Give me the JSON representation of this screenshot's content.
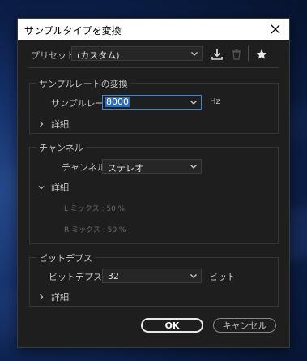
{
  "window": {
    "title": "サンプルタイプを変換"
  },
  "preset": {
    "label": "プリセット :",
    "value": "(カスタム)"
  },
  "toolbar": {
    "icons": [
      "download-icon",
      "trash-icon",
      "star-icon"
    ]
  },
  "sample_rate_group": {
    "title": "サンプルレートの変換",
    "label": "サンプルレート :",
    "value": "8000",
    "unit": "Hz",
    "details_label": "詳細",
    "details_expanded": false
  },
  "channel_group": {
    "title": "チャンネル",
    "label": "チャンネル :",
    "value": "ステレオ",
    "details_label": "詳細",
    "details_expanded": true,
    "l_mix": "L ミックス : 50 %",
    "r_mix": "R ミックス : 50 %"
  },
  "bit_depth_group": {
    "title": "ビットデプス",
    "label": "ビットデプス :",
    "value": "32",
    "unit": "ビット",
    "details_label": "詳細",
    "details_expanded": false
  },
  "buttons": {
    "ok": "OK",
    "cancel": "キャンセル"
  },
  "colors": {
    "dialog_bg": "#1e1e1e",
    "focus_blue": "#3a86d8",
    "selection": "#2a6cc4"
  }
}
